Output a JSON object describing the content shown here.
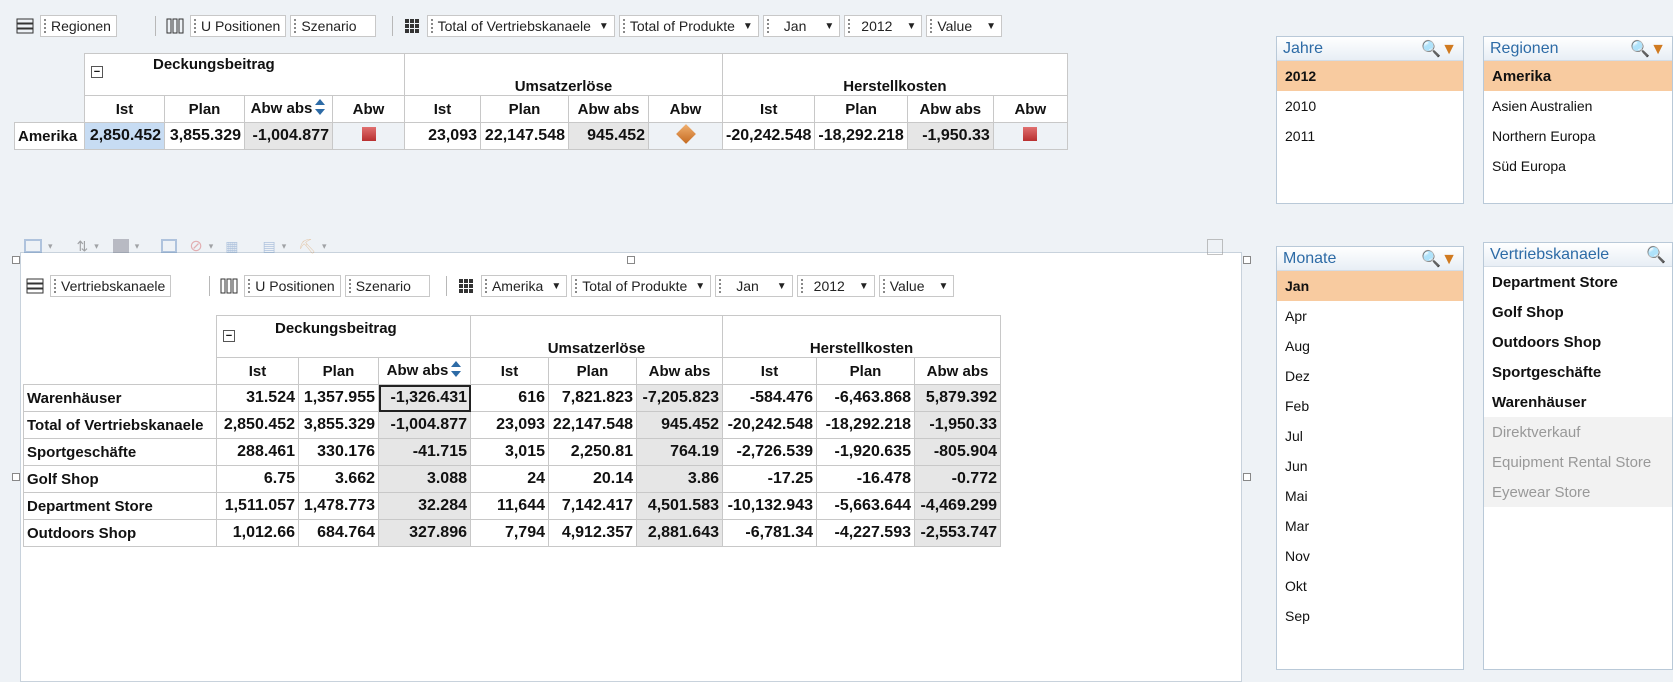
{
  "top_toolbar": {
    "rows_dim": "Regionen",
    "cols_dims": [
      "U Positionen",
      "Szenario"
    ],
    "filters": [
      "Total of Vertriebskanaele",
      "Total of Produkte",
      "Jan",
      "2012",
      "Value"
    ]
  },
  "top_table": {
    "groups": [
      "Deckungsbeitrag",
      "Umsatzerlöse",
      "Herstellkosten"
    ],
    "cols": [
      "Ist",
      "Plan",
      "Abw abs",
      "Abw",
      "Ist",
      "Plan",
      "Abw abs",
      "Abw",
      "Ist",
      "Plan",
      "Abw abs",
      "Abw"
    ],
    "row_label": "Amerika",
    "values": [
      "2,850.452",
      "3,855.329",
      "-1,004.877",
      "",
      "23,093",
      "22,147.548",
      "945.452",
      "",
      "-20,242.548",
      "-18,292.218",
      "-1,950.33",
      ""
    ],
    "indicators": [
      "red-square",
      "orange-diamond",
      "red-square"
    ]
  },
  "bottom_toolbar": {
    "rows_dim": "Vertriebskanaele",
    "cols_dims": [
      "U Positionen",
      "Szenario"
    ],
    "filters": [
      "Amerika",
      "Total of Produkte",
      "Jan",
      "2012",
      "Value"
    ]
  },
  "bottom_table": {
    "groups": [
      "Deckungsbeitrag",
      "Umsatzerlöse",
      "Herstellkosten"
    ],
    "cols": [
      "Ist",
      "Plan",
      "Abw abs",
      "Ist",
      "Plan",
      "Abw abs",
      "Ist",
      "Plan",
      "Abw abs"
    ],
    "rows": [
      {
        "label": "Warenhäuser",
        "values": [
          "31.524",
          "1,357.955",
          "-1,326.431",
          "616",
          "7,821.823",
          "-7,205.823",
          "-584.476",
          "-6,463.868",
          "5,879.392"
        ]
      },
      {
        "label": "Total of Vertriebskanaele",
        "values": [
          "2,850.452",
          "3,855.329",
          "-1,004.877",
          "23,093",
          "22,147.548",
          "945.452",
          "-20,242.548",
          "-18,292.218",
          "-1,950.33"
        ]
      },
      {
        "label": "Sportgeschäfte",
        "values": [
          "288.461",
          "330.176",
          "-41.715",
          "3,015",
          "2,250.81",
          "764.19",
          "-2,726.539",
          "-1,920.635",
          "-805.904"
        ]
      },
      {
        "label": "Golf Shop",
        "values": [
          "6.75",
          "3.662",
          "3.088",
          "24",
          "20.14",
          "3.86",
          "-17.25",
          "-16.478",
          "-0.772"
        ]
      },
      {
        "label": "Department Store",
        "values": [
          "1,511.057",
          "1,478.773",
          "32.284",
          "11,644",
          "7,142.417",
          "4,501.583",
          "-10,132.943",
          "-5,663.644",
          "-4,469.299"
        ]
      },
      {
        "label": "Outdoors Shop",
        "values": [
          "1,012.66",
          "684.764",
          "327.896",
          "7,794",
          "4,912.357",
          "2,881.643",
          "-6,781.34",
          "-4,227.593",
          "-2,553.747"
        ]
      }
    ]
  },
  "panels": {
    "jahre": {
      "title": "Jahre",
      "items": [
        "2012",
        "2010",
        "2011"
      ],
      "selected": "2012"
    },
    "regionen": {
      "title": "Regionen",
      "items": [
        "Amerika",
        "Asien Australien",
        "Northern Europa",
        "Süd Europa"
      ],
      "selected": "Amerika"
    },
    "monate": {
      "title": "Monate",
      "items": [
        "Jan",
        "Apr",
        "Aug",
        "Dez",
        "Feb",
        "Jul",
        "Jun",
        "Mai",
        "Mar",
        "Nov",
        "Okt",
        "Sep"
      ],
      "selected": "Jan"
    },
    "vertriebskanaele": {
      "title": "Vertriebskanaele",
      "items": [
        "Department Store",
        "Golf Shop",
        "Outdoors Shop",
        "Sportgeschäfte",
        "Warenhäuser"
      ],
      "disabled_items": [
        "Direktverkauf",
        "Equipment Rental Store",
        "Eyewear Store"
      ]
    }
  },
  "colors": {
    "accent": "#2d6ba6",
    "selected_bg": "#f8cba0",
    "highlight": "#c7dcf3",
    "indicator_red": "#c0392b",
    "indicator_orange": "#d9822b"
  }
}
